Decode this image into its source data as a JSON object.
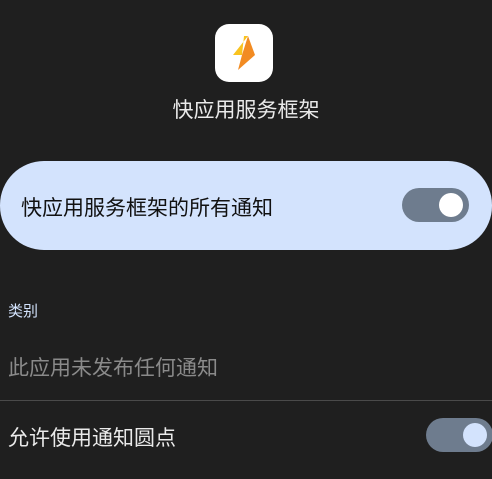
{
  "app": {
    "title": "快应用服务框架",
    "icon": "lightning-bolt-icon"
  },
  "master_toggle": {
    "label": "快应用服务框架的所有通知",
    "state": "on"
  },
  "categories": {
    "header": "类别",
    "empty_message": "此应用未发布任何通知"
  },
  "notification_dot": {
    "label": "允许使用通知圆点",
    "state": "on"
  },
  "colors": {
    "background": "#1f1f1f",
    "accent_light": "#d3e3fd",
    "switch_track": "#6e7c8e",
    "bolt_orange": "#f28b22",
    "bolt_yellow": "#f9c31f"
  }
}
